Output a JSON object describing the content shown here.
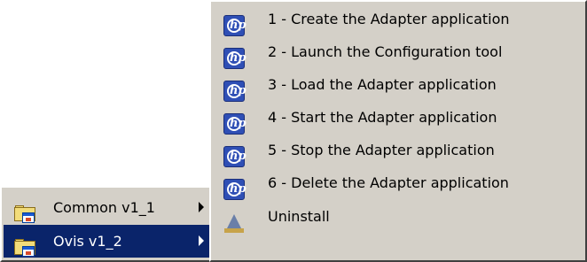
{
  "left_menu": {
    "items": [
      {
        "label": "Common v1_1",
        "icon": "program-group-folder-icon",
        "has_submenu": true,
        "selected": false
      },
      {
        "label": "Ovis v1_2",
        "icon": "program-group-folder-icon",
        "has_submenu": true,
        "selected": true
      }
    ]
  },
  "right_menu": {
    "items": [
      {
        "label": "1 - Create the Adapter application",
        "icon": "hp-logo-icon"
      },
      {
        "label": "2 - Launch the Configuration tool",
        "icon": "hp-logo-icon"
      },
      {
        "label": "3 - Load the Adapter application",
        "icon": "hp-logo-icon"
      },
      {
        "label": "4 - Start the Adapter application",
        "icon": "hp-logo-icon"
      },
      {
        "label": "5 - Stop the Adapter application",
        "icon": "hp-logo-icon"
      },
      {
        "label": "6 - Delete the Adapter application",
        "icon": "hp-logo-icon"
      },
      {
        "label": "Uninstall",
        "icon": "uninstall-icon"
      }
    ]
  },
  "colors": {
    "menu_background": "#d4d0c8",
    "selection": "#0a246a",
    "hp_blue": "#2f4fb5"
  }
}
